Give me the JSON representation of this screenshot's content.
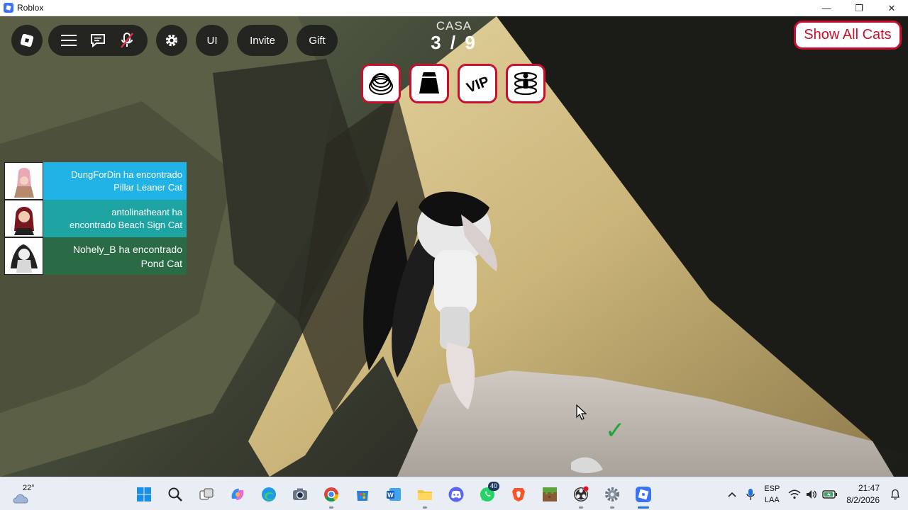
{
  "window": {
    "title": "Roblox",
    "controls": {
      "minimize": "—",
      "restore": "❐",
      "close": "✕"
    }
  },
  "hud": {
    "ui_label": "UI",
    "invite_label": "Invite",
    "gift_label": "Gift",
    "counter_label": "CASA",
    "counter_value": "3 / 9",
    "show_cats_label": "Show All Cats",
    "abilities": [
      "spring-icon",
      "cape-icon",
      "vip-icon",
      "teleport-icon"
    ],
    "ability_vip_text": "VIP"
  },
  "feed": [
    {
      "player": "DungForDin",
      "text": "DungForDin ha encontrado Pillar Leaner Cat"
    },
    {
      "player": "antolinatheant",
      "text": "antolinatheant ha encontrado Beach Sign Cat"
    },
    {
      "player": "Nohely_B",
      "text": "Nohely_B ha encontrado Pond Cat"
    }
  ],
  "feed_lines": {
    "item1_line1": "DungForDin ha encontrado",
    "item1_line2": "Pillar Leaner Cat",
    "item2_line1": "antolinatheant ha",
    "item2_line2": "encontrado Beach Sign Cat",
    "item3_line1": "Nohely_B ha encontrado",
    "item3_line2": "Pond Cat"
  },
  "taskbar": {
    "weather_temp": "22°",
    "apps": [
      "start",
      "search",
      "task-view",
      "copilot",
      "edge",
      "camera",
      "chrome",
      "store",
      "word",
      "file-explorer",
      "discord",
      "whatsapp",
      "brave",
      "minecraft",
      "obs",
      "settings",
      "roblox"
    ],
    "whatsapp_badge": "40",
    "lang_top": "ESP",
    "lang_bottom": "LAA",
    "time": "21:47",
    "date": "8/2/2026"
  },
  "colors": {
    "accent_red": "#c8102e",
    "feed_blue": "#22b3e6",
    "feed_teal": "#1fa4a4",
    "feed_green": "#2a6a45",
    "check_green": "#1fa53a"
  }
}
